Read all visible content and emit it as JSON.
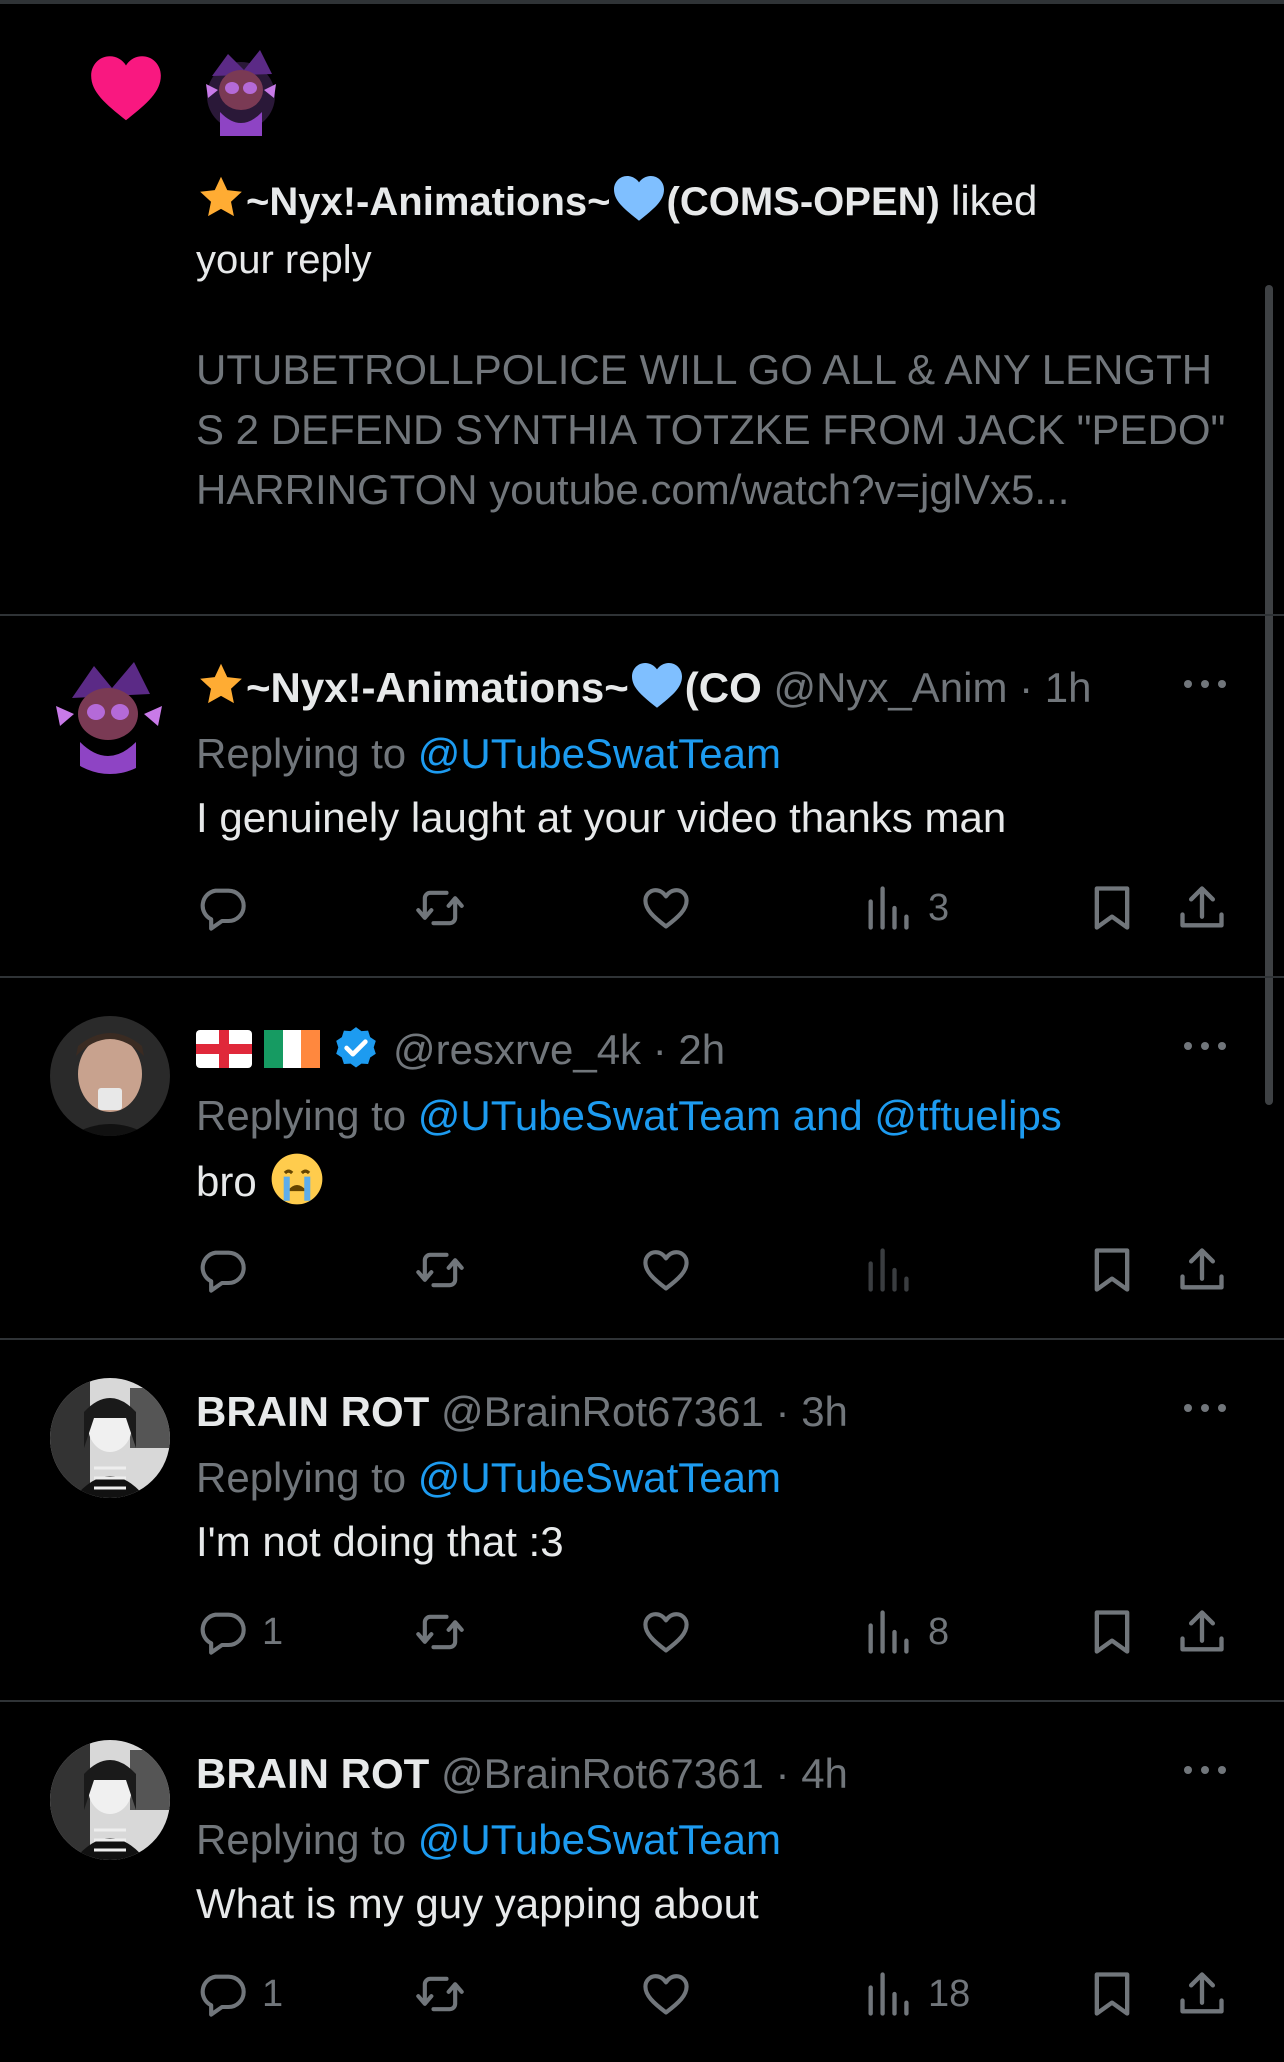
{
  "notification": {
    "actor_name": "~Nyx!-Animations~",
    "actor_suffix": "(COMS-OPEN)",
    "verb": "liked",
    "object": "your reply",
    "quoted_text": "UTUBETROLLPOLICE WILL GO ALL & ANY LENGTHS 2 DEFEND SYNTHIA TOTZKE FROM JACK \"PEDO\" HARRINGTON youtube.com/watch?v=jglVx5..."
  },
  "posts": [
    {
      "display_name": "~Nyx!-Animations~",
      "display_suffix": "(CO",
      "handle": "@Nyx_Anim",
      "dot": "·",
      "time": "1h",
      "replying_prefix": "Replying to",
      "mentions": "@UTubeSwatTeam",
      "text": "I genuinely laught at your video thanks man",
      "reply_count": "",
      "views": "3"
    },
    {
      "display_name": "",
      "handle": "@resxrve_4k",
      "dot": "·",
      "time": "2h",
      "replying_prefix": "Replying to",
      "mentions": "@UTubeSwatTeam and @tftuelips",
      "text": "bro",
      "reply_count": "",
      "views": ""
    },
    {
      "display_name": "BRAIN ROT",
      "handle": "@BrainRot67361",
      "dot": "·",
      "time": "3h",
      "replying_prefix": "Replying to",
      "mentions": "@UTubeSwatTeam",
      "text": "I'm not doing that :3",
      "reply_count": "1",
      "views": "8"
    },
    {
      "display_name": "BRAIN ROT",
      "handle": "@BrainRot67361",
      "dot": "·",
      "time": "4h",
      "replying_prefix": "Replying to",
      "mentions": "@UTubeSwatTeam",
      "text": "What is my guy yapping about",
      "reply_count": "1",
      "views": "18"
    }
  ],
  "colors": {
    "background": "#000000",
    "text": "#e7e9ea",
    "muted": "#71767b",
    "link": "#1d9bf0",
    "like_heart": "#f91880",
    "divider": "#2f3336"
  },
  "icons": [
    "heart-icon",
    "star-icon",
    "blue-heart-icon",
    "more-icon",
    "reply-icon",
    "retweet-icon",
    "like-icon",
    "views-icon",
    "bookmark-icon",
    "share-icon",
    "verified-icon",
    "england-flag-icon",
    "ireland-flag-icon",
    "crying-face-icon"
  ]
}
